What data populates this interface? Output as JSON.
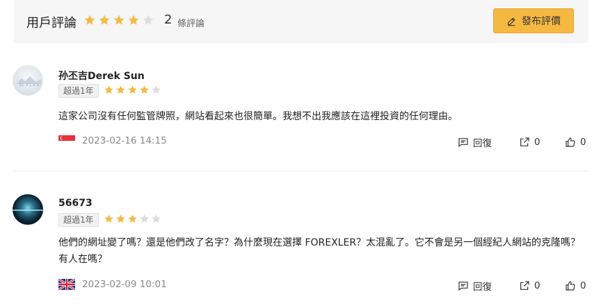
{
  "header": {
    "title": "用戶評論",
    "rating_stars": 4,
    "count": "2",
    "count_label": "條評論",
    "post_button_label": "發布評價",
    "post_button_icon": "pencil-icon",
    "accent_color": "#f5b942"
  },
  "reviews": [
    {
      "username": "孙丕吉Derek Sun",
      "avatar_text": "DL V.J.R.K",
      "badge": "超過1年",
      "stars": 4,
      "content": "這家公司沒有任何監管牌照，網站看起來也很簡單。我想不出我應該在這裡投資的任何理由。",
      "flag": "singapore-flag",
      "timestamp": "2023-02-16 14:15",
      "reply_label": "回復",
      "share_count": "0",
      "like_count": "0"
    },
    {
      "username": "56673",
      "badge": "超過1年",
      "stars": 3,
      "content": "他們的網址變了嗎？還是他們改了名字？為什麼現在選擇 FOREXLER？太混亂了。它不會是另一個經紀人網站的克隆嗎？有人在嗎？",
      "flag": "uk-flag",
      "timestamp": "2023-02-09 10:01",
      "reply_label": "回復",
      "share_count": "0",
      "like_count": "0"
    }
  ],
  "colors": {
    "star_filled": "#f5b942",
    "star_empty": "#dcdcdc",
    "header_bg": "#f6f6f6"
  }
}
